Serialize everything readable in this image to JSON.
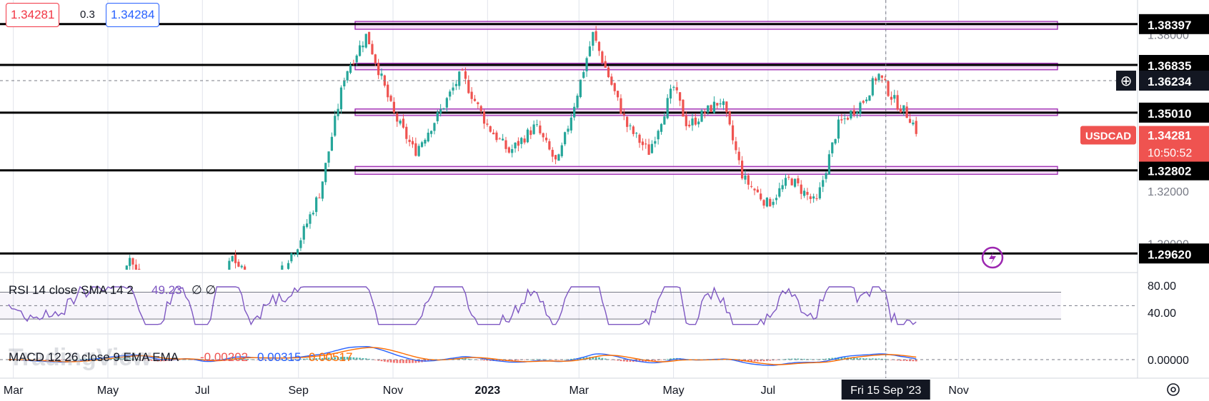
{
  "header": {
    "bid": "1.34281",
    "spread": "0.3",
    "ask": "1.34284"
  },
  "colors": {
    "up": "#26a69a",
    "down": "#ef5350",
    "zone_fill": "#f3d6f5",
    "zone_stroke": "#9c27b0",
    "rsi_line": "#7e57c2",
    "macd_line": "#2962ff",
    "signal_line": "#ff6d00",
    "bid_color": "#f23645",
    "ask_color": "#2962ff"
  },
  "chart_data": {
    "type": "candlestick",
    "symbol": "USDCAD",
    "last_price": "1.34281",
    "countdown": "10:50:52",
    "y_ticks": [
      "1.38000",
      "1.32000",
      "1.30000"
    ],
    "x_ticks": [
      "Mar",
      "May",
      "Jul",
      "Sep",
      "Nov",
      "2023",
      "Mar",
      "May",
      "Jul",
      "Fri 15 Sep '23",
      "Nov"
    ],
    "crosshair": {
      "date_label": "Fri 15 Sep '23",
      "price_label": "1.36234"
    },
    "levels": [
      {
        "value": 1.38397,
        "label": "1.38397"
      },
      {
        "value": 1.36835,
        "label": "1.36835"
      },
      {
        "value": 1.3501,
        "label": "1.35010"
      },
      {
        "value": 1.32802,
        "label": "1.32802"
      },
      {
        "value": 1.2962,
        "label": "1.29620"
      }
    ],
    "zones": [
      {
        "from": 1.382,
        "to": 1.385
      },
      {
        "from": 1.3665,
        "to": 1.369
      },
      {
        "from": 1.349,
        "to": 1.3515
      },
      {
        "from": 1.3265,
        "to": 1.3295
      }
    ],
    "close_path": [
      [
        "2022-03",
        1.27
      ],
      [
        "2022-04",
        1.255
      ],
      [
        "2022-05",
        1.28
      ],
      [
        "2022-05-15",
        1.295
      ],
      [
        "2022-06",
        1.27
      ],
      [
        "2022-06-20",
        1.285
      ],
      [
        "2022-07",
        1.26
      ],
      [
        "2022-07-20",
        1.295
      ],
      [
        "2022-08",
        1.285
      ],
      [
        "2022-08-20",
        1.29
      ],
      [
        "2022-09",
        1.3
      ],
      [
        "2022-09-15",
        1.32
      ],
      [
        "2022-10",
        1.365
      ],
      [
        "2022-10-15",
        1.38
      ],
      [
        "2022-11",
        1.35
      ],
      [
        "2022-11-15",
        1.335
      ],
      [
        "2022-12",
        1.35
      ],
      [
        "2022-12-15",
        1.365
      ],
      [
        "2023-01",
        1.345
      ],
      [
        "2023-01-15",
        1.335
      ],
      [
        "2023-02",
        1.345
      ],
      [
        "2023-02-15",
        1.33
      ],
      [
        "2023-03",
        1.36
      ],
      [
        "2023-03-10",
        1.38
      ],
      [
        "2023-04",
        1.345
      ],
      [
        "2023-04-15",
        1.335
      ],
      [
        "2023-05",
        1.36
      ],
      [
        "2023-05-10",
        1.345
      ],
      [
        "2023-06",
        1.355
      ],
      [
        "2023-06-15",
        1.325
      ],
      [
        "2023-07",
        1.315
      ],
      [
        "2023-07-15",
        1.325
      ],
      [
        "2023-08",
        1.315
      ],
      [
        "2023-08-15",
        1.345
      ],
      [
        "2023-09",
        1.355
      ],
      [
        "2023-09-10",
        1.365
      ],
      [
        "2023-09-20",
        1.355
      ],
      [
        "2023-10",
        1.348
      ],
      [
        "2023-10-05",
        1.3428
      ]
    ],
    "rsi": {
      "title": "RSI 14 close SMA 14 2",
      "value": "49.23",
      "extras": "∅ ∅",
      "ticks": [
        "80.00",
        "40.00"
      ],
      "upper": 70,
      "lower": 30,
      "mid": 50
    },
    "macd": {
      "title": "MACD 12 26 close 9 EMA EMA",
      "histogram": "-0.00202",
      "macd": "0.00315",
      "signal": "0.00517",
      "ticks": [
        "0.00000"
      ]
    }
  },
  "watermark": "TradingView",
  "tags": {
    "symbol_tag": "USDCAD"
  }
}
